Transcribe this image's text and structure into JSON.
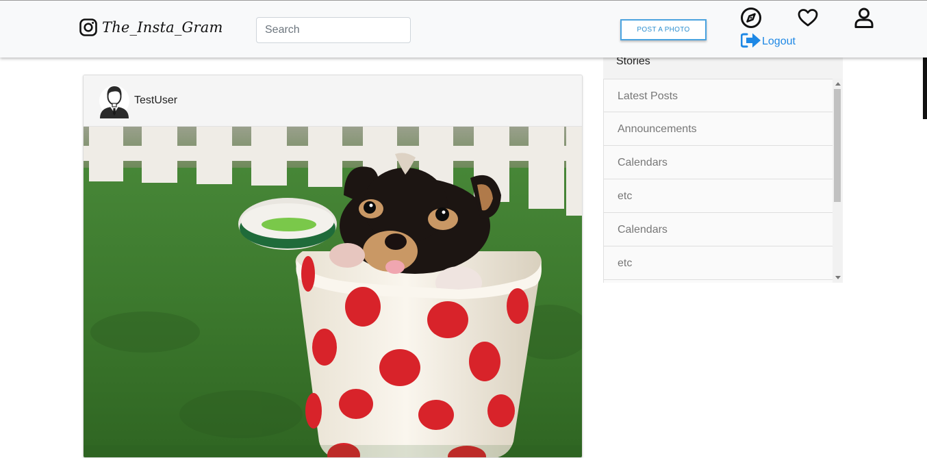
{
  "navbar": {
    "brand_name": "The_Insta_Gram",
    "search_placeholder": "Search",
    "post_button_label": "POST A PHOTO",
    "logout_label": "Logout",
    "icons": [
      "instagram-icon",
      "compass-icon",
      "heart-icon",
      "user-icon",
      "logout-arrow-icon"
    ],
    "logout_color": "#1e88e5",
    "post_button_border_color": "#4aa3df"
  },
  "post": {
    "username": "TestUser",
    "image_alt": "puppy in a red polka-dot cup on grass"
  },
  "stories": {
    "title": "Stories",
    "items": [
      {
        "label": "Latest Posts"
      },
      {
        "label": "Announcements"
      },
      {
        "label": "Calendars"
      },
      {
        "label": "etc"
      },
      {
        "label": "Calendars"
      },
      {
        "label": "etc"
      }
    ]
  }
}
